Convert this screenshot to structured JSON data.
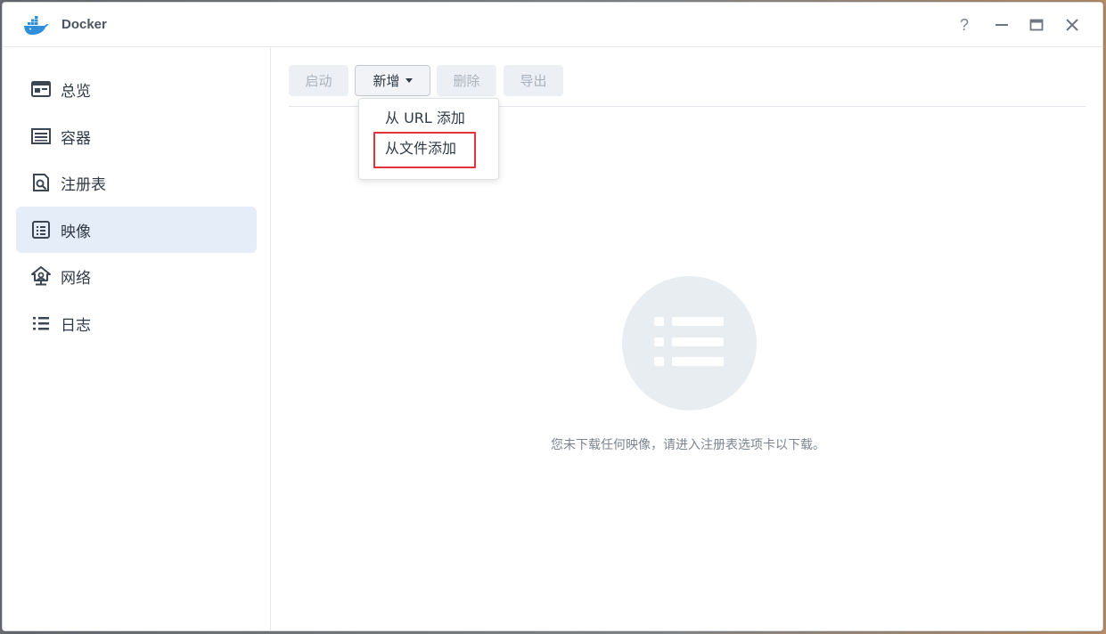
{
  "window": {
    "title": "Docker",
    "controls": {
      "help_label": "?"
    }
  },
  "sidebar": {
    "items": [
      {
        "label": "总览",
        "icon": "overview-icon"
      },
      {
        "label": "容器",
        "icon": "container-icon"
      },
      {
        "label": "注册表",
        "icon": "registry-icon"
      },
      {
        "label": "映像",
        "icon": "image-icon",
        "active": true
      },
      {
        "label": "网络",
        "icon": "network-icon"
      },
      {
        "label": "日志",
        "icon": "log-icon"
      }
    ]
  },
  "toolbar": {
    "start_label": "启动",
    "add_label": "新增",
    "delete_label": "删除",
    "export_label": "导出"
  },
  "add_menu": {
    "items": [
      {
        "label": "从 URL 添加"
      },
      {
        "label": "从文件添加",
        "highlighted": true
      }
    ]
  },
  "empty_state": {
    "message": "您未下载任何映像，请进入注册表选项卡以下载。"
  },
  "colors": {
    "accent": "#e5eef8",
    "highlight_border": "#e2333b",
    "docker_blue": "#2f8fd8"
  }
}
